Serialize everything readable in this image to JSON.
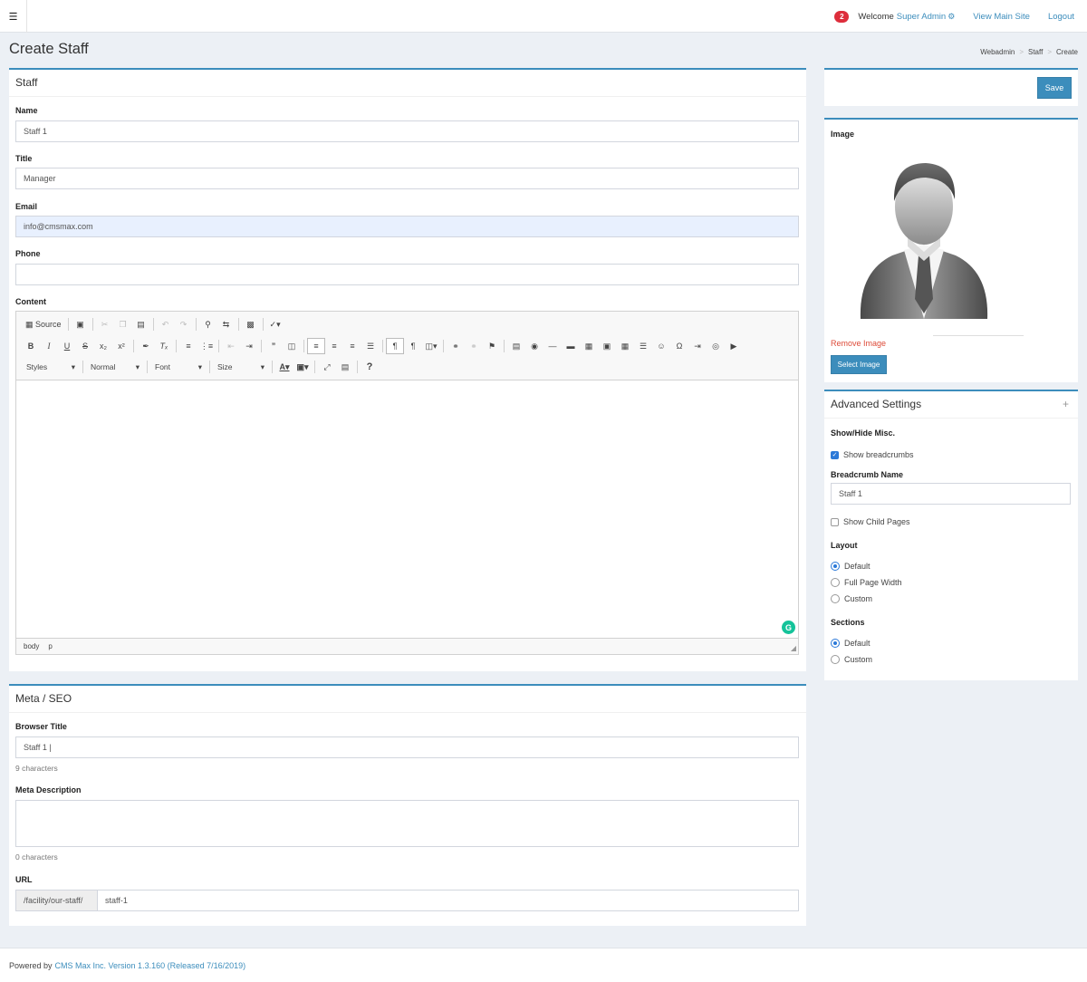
{
  "header": {
    "badge_count": "2",
    "welcome": "Welcome",
    "user": "Super Admin",
    "view_site": "View Main Site",
    "logout": "Logout"
  },
  "page": {
    "title": "Create Staff"
  },
  "breadcrumb": [
    "Webadmin",
    "Staff",
    "Create"
  ],
  "staff_box": {
    "title": "Staff",
    "name_label": "Name",
    "name_value": "Staff 1",
    "title_label": "Title",
    "title_value": "Manager",
    "email_label": "Email",
    "email_value": "info@cmsmax.com",
    "phone_label": "Phone",
    "phone_value": "",
    "content_label": "Content"
  },
  "editor": {
    "source_label": "Source",
    "styles": "Styles",
    "format": "Normal",
    "font": "Font",
    "size": "Size",
    "path": [
      "body",
      "p"
    ]
  },
  "meta_box": {
    "title": "Meta / SEO",
    "browser_title_label": "Browser Title",
    "browser_title_value": "Staff 1 |",
    "browser_title_count": "9 characters",
    "meta_desc_label": "Meta Description",
    "meta_desc_count": "0 characters",
    "url_label": "URL",
    "url_prefix": "/facility/our-staff/",
    "url_value": "staff-1"
  },
  "save_box": {
    "save_label": "Save"
  },
  "image_box": {
    "label": "Image",
    "remove_label": "Remove Image",
    "select_label": "Select Image"
  },
  "advanced": {
    "title": "Advanced Settings",
    "toggle": "+",
    "misc_label": "Show/Hide Misc.",
    "show_breadcrumbs": "Show breadcrumbs",
    "breadcrumb_name_label": "Breadcrumb Name",
    "breadcrumb_name_value": "Staff 1",
    "show_child_pages": "Show Child Pages",
    "layout_label": "Layout",
    "layout_options": [
      "Default",
      "Full Page Width",
      "Custom"
    ],
    "sections_label": "Sections",
    "sections_options": [
      "Default",
      "Custom"
    ]
  },
  "footer": {
    "powered": "Powered by",
    "link": "CMS Max Inc. Version 1.3.160 (Released 7/16/2019)"
  },
  "colors": {
    "primary": "#3c8dbc",
    "danger": "#dd2d3b",
    "bg": "#ecf0f5"
  }
}
